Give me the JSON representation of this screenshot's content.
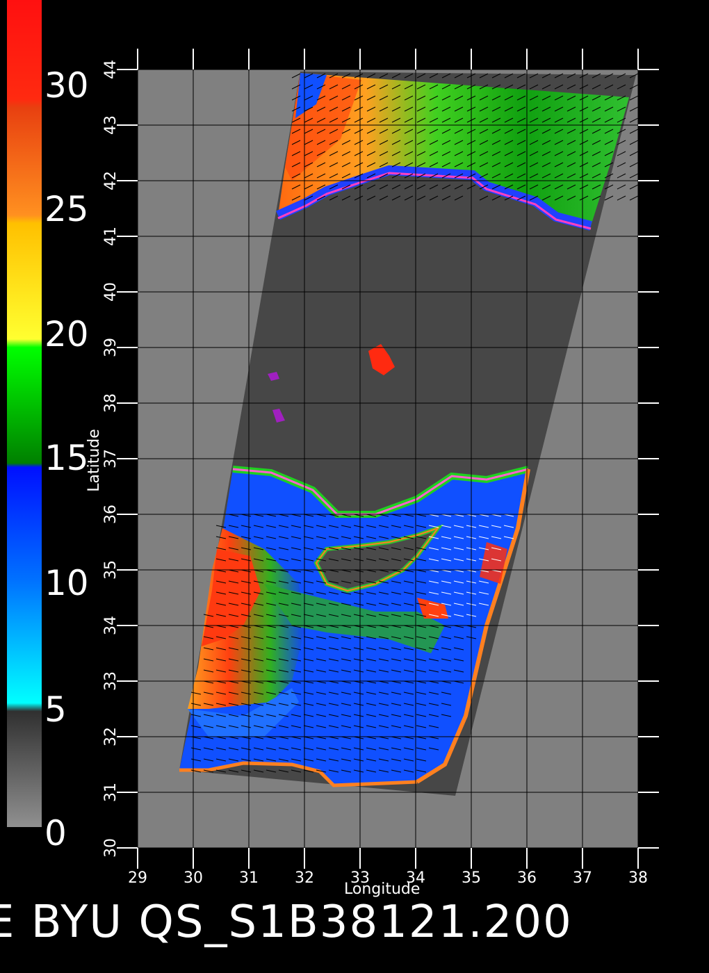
{
  "colorbar": {
    "labels": [
      "30",
      "25",
      "20",
      "15",
      "10",
      "5",
      "0"
    ],
    "colors": {
      "red": "#ff1a10",
      "orange": "#ff8a20",
      "yellow": "#ffe020",
      "green": "#00e000",
      "darkgreen": "#008000",
      "blue": "#0020ff",
      "cyan": "#00e8ff",
      "dark": "#333333",
      "grey": "#808080"
    }
  },
  "axes": {
    "xlabel": "Longitude",
    "ylabel": "Latitude",
    "xticks": [
      "29",
      "30",
      "31",
      "32",
      "33",
      "34",
      "35",
      "36",
      "37",
      "38"
    ],
    "yticks": [
      "30",
      "31",
      "32",
      "33",
      "34",
      "35",
      "36",
      "37",
      "38",
      "39",
      "40",
      "41",
      "42",
      "43",
      "44"
    ]
  },
  "title": "E  BYU QS_S1B38121.200",
  "colors": {
    "background": "#000000",
    "land": "#808080",
    "nodata": "#474747",
    "grid": "#000000"
  }
}
